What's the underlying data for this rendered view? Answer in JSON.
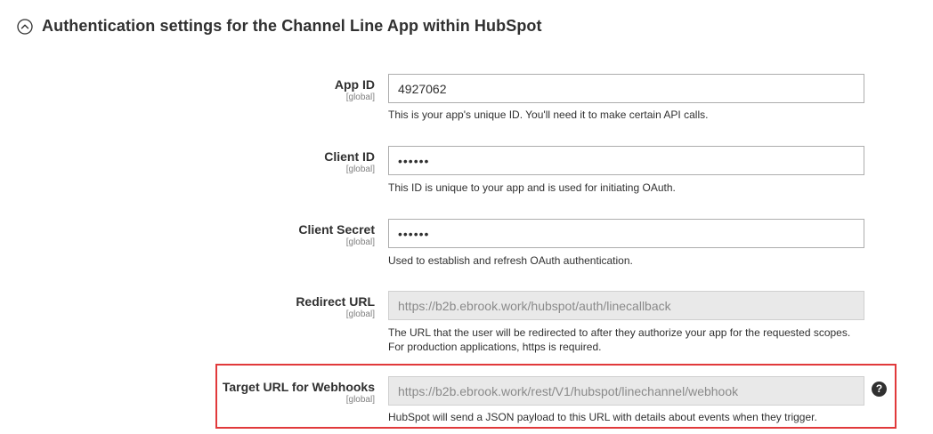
{
  "section": {
    "title": "Authentication settings for the Channel Line App within HubSpot",
    "toggle_icon": "chevron-up-circle-icon"
  },
  "fields": {
    "app_id": {
      "label": "App ID",
      "scope": "[global]",
      "value": "4927062",
      "note": "This is your app's unique ID. You'll need it to make certain API calls."
    },
    "client_id": {
      "label": "Client ID",
      "scope": "[global]",
      "value": "••••••",
      "note": "This ID is unique to your app and is used for initiating OAuth."
    },
    "client_secret": {
      "label": "Client Secret",
      "scope": "[global]",
      "value": "••••••",
      "note": "Used to establish and refresh OAuth authentication."
    },
    "redirect_url": {
      "label": "Redirect URL",
      "scope": "[global]",
      "value": "https://b2b.ebrook.work/hubspot/auth/linecallback",
      "note": "The URL that the user will be redirected to after they authorize your app for the requested scopes. For production applications, https is required."
    },
    "webhook_url": {
      "label": "Target URL for Webhooks",
      "scope": "[global]",
      "value": "https://b2b.ebrook.work/rest/V1/hubspot/linechannel/webhook",
      "note": "HubSpot will send a JSON payload to this URL with details about events when they trigger.",
      "help": "?"
    }
  },
  "colors": {
    "highlight": "#e1393b",
    "text": "#303030",
    "scope": "#808080",
    "disabled_bg": "#e9e9e9"
  }
}
